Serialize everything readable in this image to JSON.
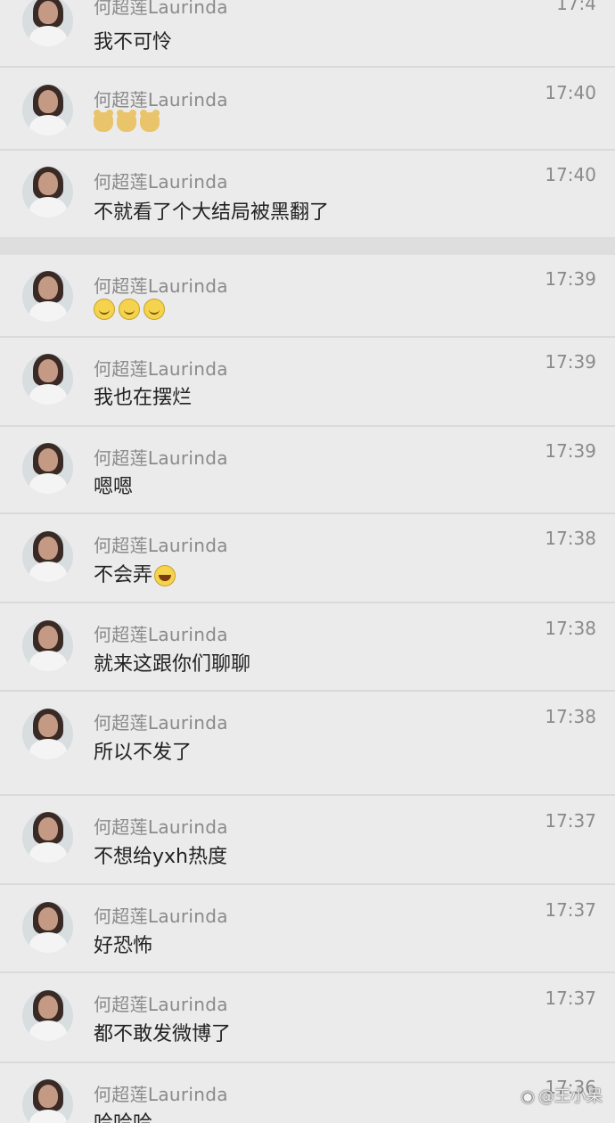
{
  "sender_name": "何超莲Laurinda",
  "messages": [
    {
      "text": "我不可怜",
      "time": "17:4",
      "emoji": ""
    },
    {
      "text": "",
      "time": "17:40",
      "emoji": "bear3"
    },
    {
      "text": "不就看了个大结局被黑翻了",
      "time": "17:40",
      "emoji": ""
    },
    {
      "text": "",
      "time": "17:39",
      "emoji": "smile3"
    },
    {
      "text": "我也在摆烂",
      "time": "17:39",
      "emoji": ""
    },
    {
      "text": "嗯嗯",
      "time": "17:39",
      "emoji": ""
    },
    {
      "text": "不会弄",
      "time": "17:38",
      "emoji": "laugh"
    },
    {
      "text": "就来这跟你们聊聊",
      "time": "17:38",
      "emoji": ""
    },
    {
      "text": "所以不发了",
      "time": "17:38",
      "emoji": ""
    },
    {
      "text": "不想给yxh热度",
      "time": "17:37",
      "emoji": ""
    },
    {
      "text": "好恐怖",
      "time": "17:37",
      "emoji": ""
    },
    {
      "text": "都不敢发微博了",
      "time": "17:37",
      "emoji": ""
    },
    {
      "text": "哈哈哈",
      "time": "17:36",
      "emoji": ""
    }
  ],
  "watermark": "@王小呆",
  "icons": {
    "avatar": "profile-photo",
    "watermark_logo": "weibo-icon"
  }
}
